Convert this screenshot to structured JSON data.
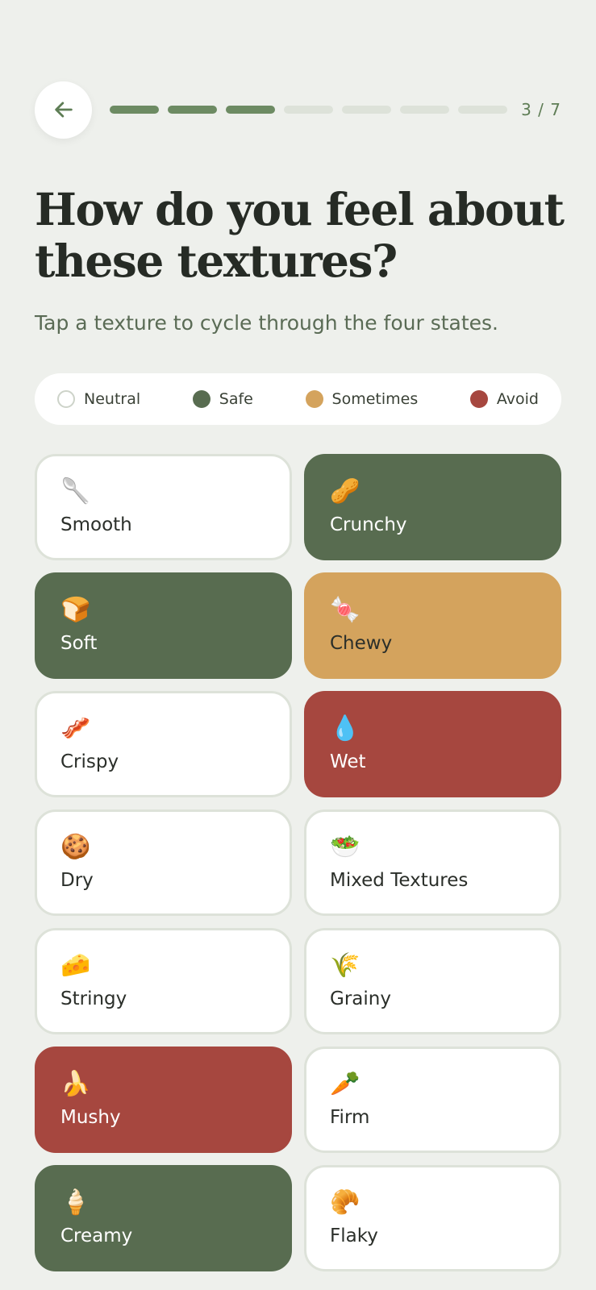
{
  "header": {
    "back_icon": "arrow-left-icon",
    "progress": {
      "current": 3,
      "total": 7
    },
    "step_label": "3 / 7"
  },
  "title": "How do you feel about these textures?",
  "subtitle": "Tap a texture to cycle through the four states.",
  "legend": [
    {
      "label": "Neutral",
      "state": "neutral",
      "color": "#ffffff"
    },
    {
      "label": "Safe",
      "state": "safe",
      "color": "#586c50"
    },
    {
      "label": "Sometimes",
      "state": "sometimes",
      "color": "#d4a35d"
    },
    {
      "label": "Avoid",
      "state": "avoid",
      "color": "#a6473f"
    }
  ],
  "textures": [
    {
      "label": "Smooth",
      "emoji": "🥄",
      "state": "neutral"
    },
    {
      "label": "Crunchy",
      "emoji": "🥜",
      "state": "safe"
    },
    {
      "label": "Soft",
      "emoji": "🍞",
      "state": "safe"
    },
    {
      "label": "Chewy",
      "emoji": "🍬",
      "state": "sometimes"
    },
    {
      "label": "Crispy",
      "emoji": "🥓",
      "state": "neutral"
    },
    {
      "label": "Wet",
      "emoji": "💧",
      "state": "avoid"
    },
    {
      "label": "Dry",
      "emoji": "🍪",
      "state": "neutral"
    },
    {
      "label": "Mixed Textures",
      "emoji": "🥗",
      "state": "neutral"
    },
    {
      "label": "Stringy",
      "emoji": "🧀",
      "state": "neutral"
    },
    {
      "label": "Grainy",
      "emoji": "🌾",
      "state": "neutral"
    },
    {
      "label": "Mushy",
      "emoji": "🍌",
      "state": "avoid"
    },
    {
      "label": "Firm",
      "emoji": "🥕",
      "state": "neutral"
    },
    {
      "label": "Creamy",
      "emoji": "🍦",
      "state": "safe"
    },
    {
      "label": "Flaky",
      "emoji": "🥐",
      "state": "neutral"
    }
  ]
}
